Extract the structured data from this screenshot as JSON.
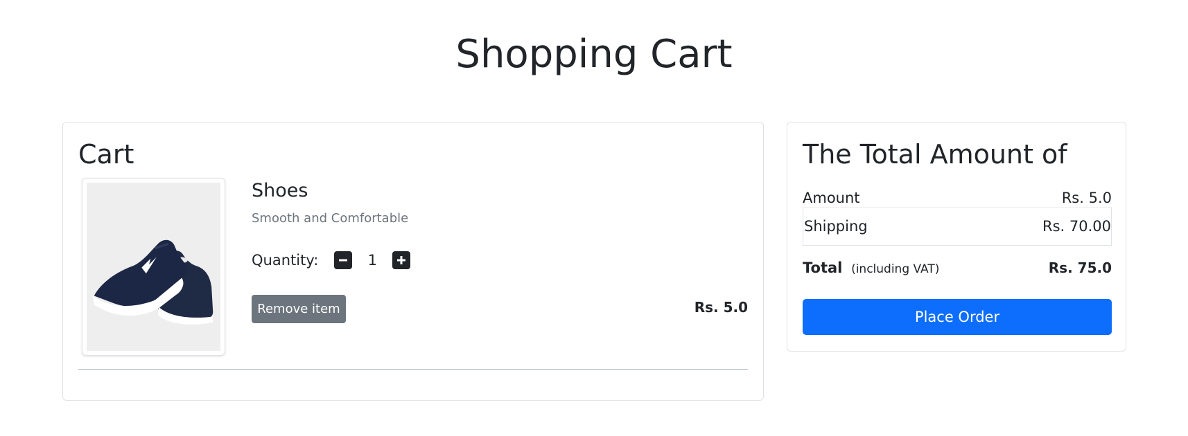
{
  "page": {
    "title": "Shopping Cart"
  },
  "cart": {
    "heading": "Cart",
    "items": [
      {
        "name": "Shoes",
        "description": "Smooth and Comfortable",
        "quantity_label": "Quantity:",
        "quantity": "1",
        "remove_label": "Remove item",
        "price": "Rs. 5.0",
        "image_alt": "navy-running-shoes"
      }
    ]
  },
  "summary": {
    "heading": "The Total Amount of",
    "amount_label": "Amount",
    "amount_value": "Rs. 5.0",
    "shipping_label": "Shipping",
    "shipping_value": "Rs. 70.00",
    "total_label": "Total",
    "total_note": "(including VAT)",
    "total_value": "Rs. 75.0",
    "place_order_label": "Place Order"
  },
  "colors": {
    "primary": "#0d6efd",
    "secondary": "#6c757d",
    "dark": "#212529",
    "border": "#dee2e6"
  },
  "icons": {
    "decrease": "minus-square-icon",
    "increase": "plus-square-icon"
  }
}
